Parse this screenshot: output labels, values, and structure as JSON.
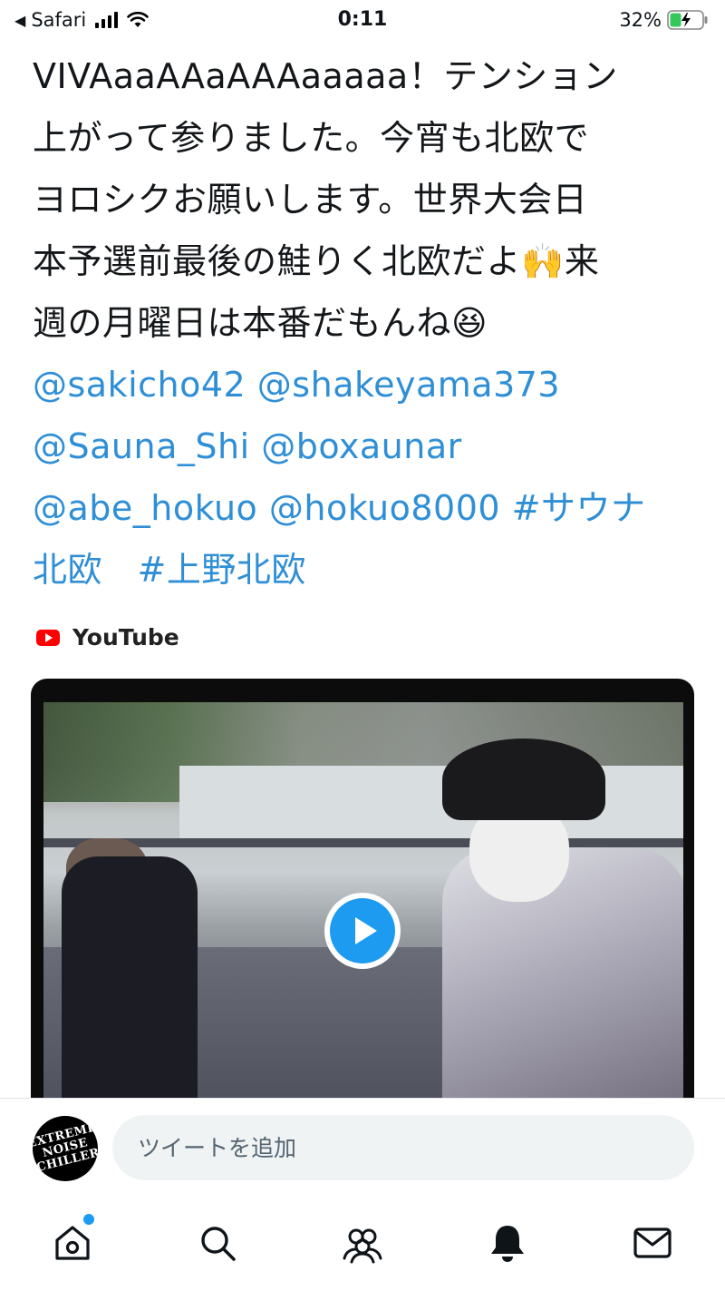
{
  "status_bar": {
    "back_app": "Safari",
    "time": "0:11",
    "battery": "32%"
  },
  "tweet": {
    "lines": [
      [
        {
          "text": "VIVAaaAAaAAAaaaaa！テンション",
          "link": false
        }
      ],
      [
        {
          "text": "上がって参りました。今宵も北欧で",
          "link": false
        }
      ],
      [
        {
          "text": "ヨロシクお願いします。世界大会日",
          "link": false
        }
      ],
      [
        {
          "text": "本予選前最後の鮭りく北欧だよ🙌来",
          "link": false
        }
      ],
      [
        {
          "text": "週の月曜日は本番だもんね😆",
          "link": false
        }
      ],
      [
        {
          "text": "@sakicho42 @shakeyama373",
          "link": true
        }
      ],
      [
        {
          "text": "@Sauna_Shi @boxaunar",
          "link": true
        }
      ],
      [
        {
          "text": "@abe_hokuo @hokuo8000 #サウナ",
          "link": true
        }
      ],
      [
        {
          "text": "北欧　#上野北欧",
          "link": true
        }
      ]
    ]
  },
  "card": {
    "source": "YouTube"
  },
  "reply": {
    "avatar_text": "EXTREME NOISE CHILLER",
    "placeholder": "ツイートを追加"
  },
  "colors": {
    "link": "#2f8fd6",
    "accent": "#1d9bf0"
  },
  "tabs": [
    "home-icon",
    "search-icon",
    "communities-icon",
    "notifications-icon",
    "messages-icon"
  ]
}
